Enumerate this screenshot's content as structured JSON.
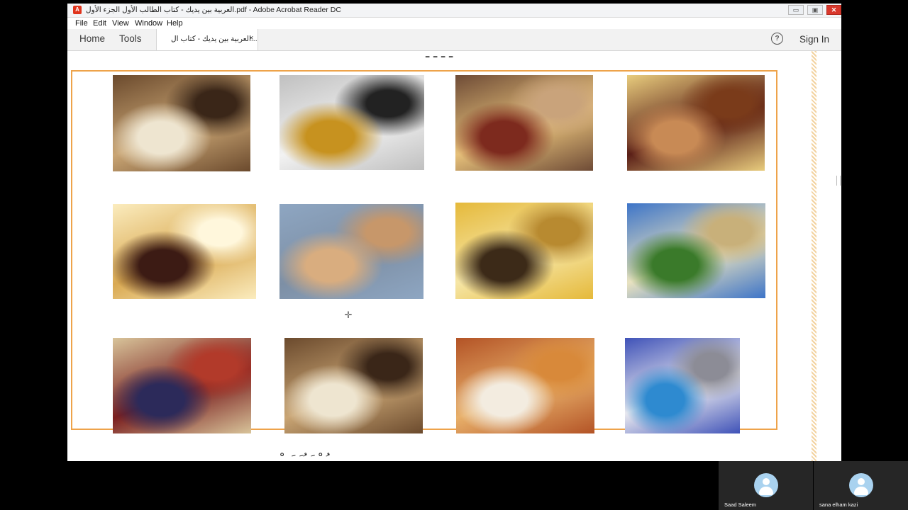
{
  "window": {
    "title": "العربية بين يديك - كتاب الطالب الأول الجزء الأول.pdf - Adobe Acrobat Reader DC",
    "app_icon": "pdf-icon",
    "min_glyph": "▭",
    "max_glyph": "▣",
    "close_glyph": "✕"
  },
  "menu": {
    "file": "File",
    "edit": "Edit",
    "view": "View",
    "window": "Window",
    "help": "Help"
  },
  "toolbar": {
    "home": "Home",
    "tools": "Tools",
    "doc_tab": "العربية بين يديك - كتاب ال...",
    "doc_tab_close": "×",
    "help_glyph": "?",
    "sign_in": "Sign In"
  },
  "document": {
    "top_text_fragment": "ـ ـ ـ ـ",
    "bottom_text_fragment": "ـُــْــَ ـُـَ ـَـ ـْ",
    "photos": [
      {
        "name": "photo-bedroom",
        "colors": [
          "#6b4a2d",
          "#c9a574",
          "#eee5d0",
          "#3a2618"
        ]
      },
      {
        "name": "photo-mirror",
        "colors": [
          "#c0c0c0",
          "#f2f2f2",
          "#c7921f",
          "#222222"
        ]
      },
      {
        "name": "photo-living-room",
        "colors": [
          "#6e4b36",
          "#e6c07a",
          "#7d2a1e",
          "#c9a37b"
        ]
      },
      {
        "name": "photo-bedroom-windows",
        "colors": [
          "#e8cc7d",
          "#5a1f17",
          "#c88a55",
          "#7a3b1a"
        ]
      },
      {
        "name": "photo-hallway",
        "colors": [
          "#fbecbe",
          "#d9a952",
          "#3c1b14",
          "#fff7dc"
        ]
      },
      {
        "name": "photo-building",
        "colors": [
          "#8ea6c2",
          "#7d8fa5",
          "#d9ad7f",
          "#c7976a"
        ]
      },
      {
        "name": "photo-bathroom",
        "colors": [
          "#e5b93a",
          "#f6e6a6",
          "#3c2a18",
          "#b88a30"
        ]
      },
      {
        "name": "photo-villa",
        "colors": [
          "#3d74c8",
          "#e8e2c0",
          "#3a7a2a",
          "#c8b07a"
        ]
      },
      {
        "name": "photo-rug",
        "colors": [
          "#d8c49a",
          "#7a1f1f",
          "#2c2a5a",
          "#b23a2a"
        ]
      },
      {
        "name": "photo-bedroom-2",
        "colors": [
          "#6b4a2d",
          "#c9a574",
          "#eee5d0",
          "#3a2618"
        ]
      },
      {
        "name": "photo-dining-room",
        "colors": [
          "#b35326",
          "#e8b06a",
          "#f3ece0",
          "#d8893a"
        ]
      },
      {
        "name": "photo-alley",
        "colors": [
          "#3f52b8",
          "#e9e9ef",
          "#2e8ad0",
          "#8c8c96"
        ]
      }
    ]
  },
  "cursor_glyph": "✛",
  "participants": [
    {
      "name": "Saad Saleem"
    },
    {
      "name": "sana elham kazi"
    }
  ]
}
